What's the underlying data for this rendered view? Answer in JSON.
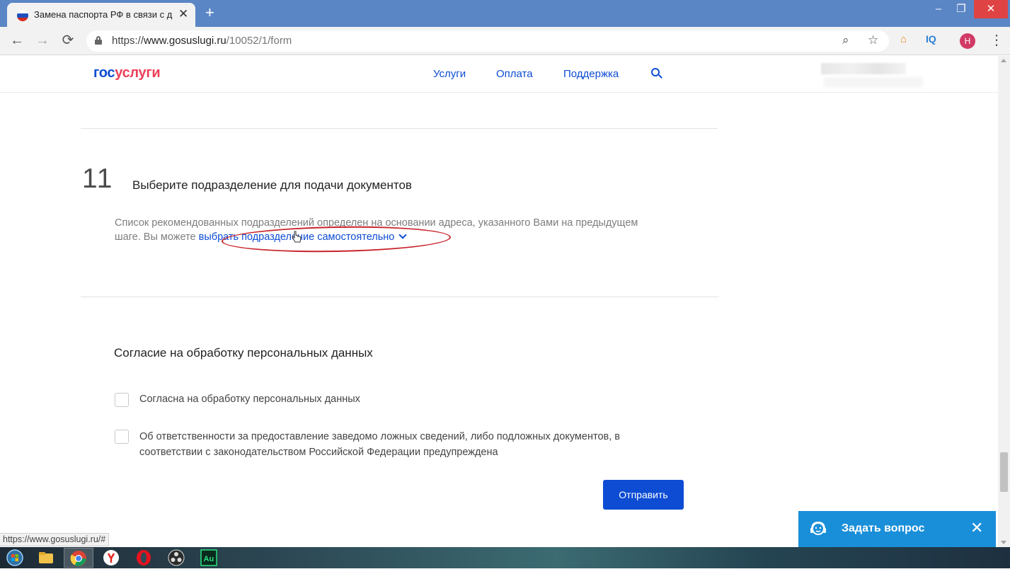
{
  "browser": {
    "tab_title": "Замена паспорта РФ в связи с д",
    "tab_close": "✕",
    "new_tab": "+",
    "url_scheme": "https://",
    "url_host": "www.gosuslugi.ru",
    "url_path": "/10052/1/form",
    "window_controls": {
      "minimize": "–",
      "maximize": "❐",
      "close": "✕"
    },
    "extension_iq": "IQ",
    "profile_initial": "H"
  },
  "header": {
    "logo_gos": "гос",
    "logo_uslugi": "услуги",
    "nav": [
      "Услуги",
      "Оплата",
      "Поддержка"
    ]
  },
  "step": {
    "number": "11",
    "title": "Выберите подразделение для подачи документов",
    "desc_line1": "Список рекомендованных подразделений определен на основании адреса, указанного Вами на предыдущем",
    "desc_line2_prefix": "шаге. Вы можете ",
    "desc_link": "выбрать подразделение самостоятельно"
  },
  "consent": {
    "title": "Согласие на обработку персональных данных",
    "items": [
      {
        "label": "Согласна на обработку персональных данных",
        "checked": false
      },
      {
        "label_line1": "Об ответственности за предоставление заведомо ложных сведений, либо подложных документов, в",
        "label_line2": "соответствии с законодательством Российской Федерации предупреждена",
        "checked": false
      }
    ],
    "submit_label": "Отправить"
  },
  "status_bar_url": "https://www.gosuslugi.ru/#",
  "chat_widget": {
    "label": "Задать вопрос",
    "close": "✕"
  },
  "colors": {
    "brand_blue": "#0d4cd3",
    "brand_red": "#ee3f58",
    "chat_blue": "#1a8fd9",
    "annotation_red": "#c8232b",
    "titlebar": "#5b86c5"
  },
  "taskbar_apps": [
    "start-orb-icon",
    "file-explorer-icon",
    "chrome-icon",
    "yandex-browser-icon",
    "opera-icon",
    "obs-icon",
    "audition-icon"
  ]
}
